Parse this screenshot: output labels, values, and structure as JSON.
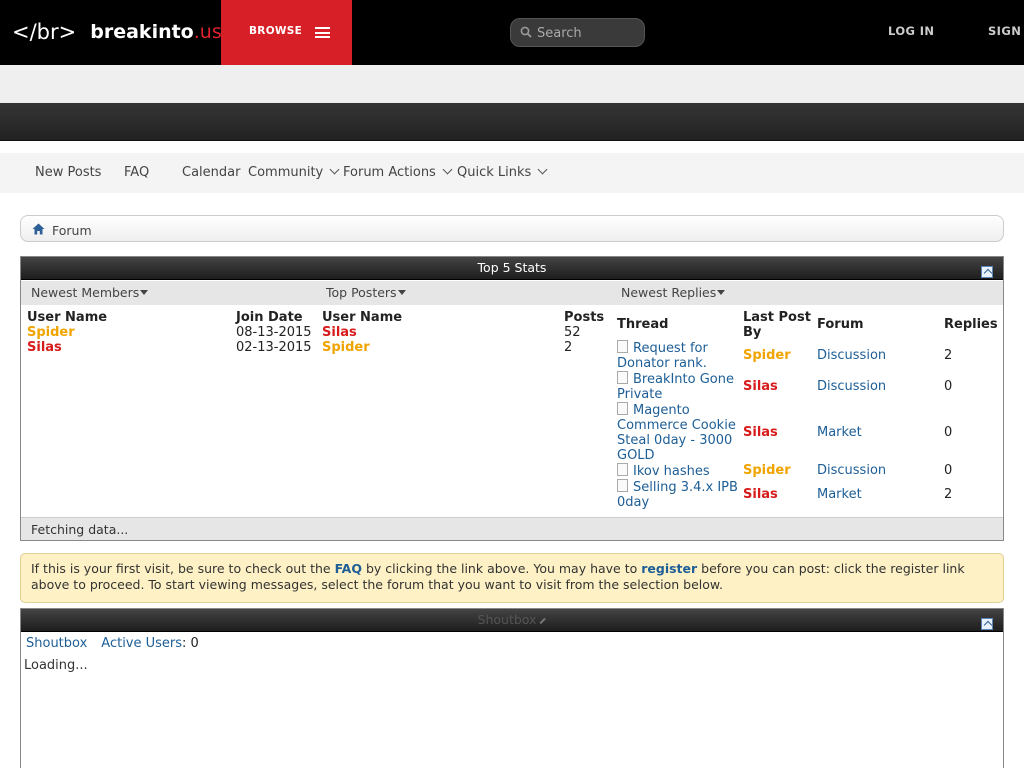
{
  "header": {
    "logo_tag_open": "</",
    "logo_tag_mid": "br",
    "logo_tag_close": ">",
    "logo_name": "breakinto",
    "logo_tld": ".us",
    "browse_label": "BROWSE",
    "search_placeholder": "Search",
    "login_label": "LOG IN",
    "signup_label": "SIGN"
  },
  "nav": {
    "items": [
      "New Posts",
      "FAQ",
      "Calendar",
      "Community",
      "Forum Actions",
      "Quick Links"
    ]
  },
  "breadcrumb": {
    "label": "Forum"
  },
  "stats": {
    "title": "Top 5 Stats",
    "tabs": [
      "Newest Members",
      "Top Posters",
      "Newest Replies"
    ],
    "members": {
      "headers": [
        "User Name",
        "Join Date"
      ],
      "rows": [
        {
          "name": "Spider",
          "date": "08-13-2015"
        },
        {
          "name": "Silas",
          "date": "02-13-2015"
        }
      ]
    },
    "posters": {
      "headers": [
        "User Name",
        "Posts"
      ],
      "rows": [
        {
          "name": "Silas",
          "posts": "52"
        },
        {
          "name": "Spider",
          "posts": "2"
        }
      ]
    },
    "replies": {
      "headers": [
        "Thread",
        "Last Post",
        "By",
        "Forum",
        "Replies"
      ],
      "rows": [
        {
          "thread_l1": "Request for",
          "thread_l2": "Donator rank.",
          "thread_l3": "",
          "thread_l4": "",
          "by": "Spider",
          "forum": "Discussion",
          "replies": "2"
        },
        {
          "thread_l1": "BreakInto Gone",
          "thread_l2": "Private",
          "thread_l3": "",
          "thread_l4": "",
          "by": "Silas",
          "forum": "Discussion",
          "replies": "0"
        },
        {
          "thread_l1": "Magento",
          "thread_l2": "Commerce Cookie",
          "thread_l3": "Steal 0day - 3000",
          "thread_l4": "GOLD",
          "by": "Silas",
          "forum": "Market",
          "replies": "0"
        },
        {
          "thread_l1": "Ikov hashes",
          "thread_l2": "",
          "thread_l3": "",
          "thread_l4": "",
          "by": "Spider",
          "forum": "Discussion",
          "replies": "0"
        },
        {
          "thread_l1": "Selling 3.4.x IPB",
          "thread_l2": "0day",
          "thread_l3": "",
          "thread_l4": "",
          "by": "Silas",
          "forum": "Market",
          "replies": "2"
        }
      ]
    },
    "fetching": "Fetching data..."
  },
  "notice": {
    "t1": "If this is your first visit, be sure to check out the ",
    "faq": "FAQ",
    "t2": " by clicking the link above. You may have to ",
    "register": "register",
    "t3": " before you can post: click the register link above to proceed. To start viewing messages, select the forum that you want to visit from the selection below."
  },
  "shoutbox": {
    "title": "Shoutbox",
    "tab": "Shoutbox",
    "active_label": "Active Users",
    "active_sep": ": ",
    "active_count": "0",
    "loading": "Loading..."
  },
  "colors": {
    "brand_red": "#d61f26",
    "user_orange": "#f0a400",
    "user_red": "#d81b1b",
    "link_blue": "#1d5e96"
  }
}
